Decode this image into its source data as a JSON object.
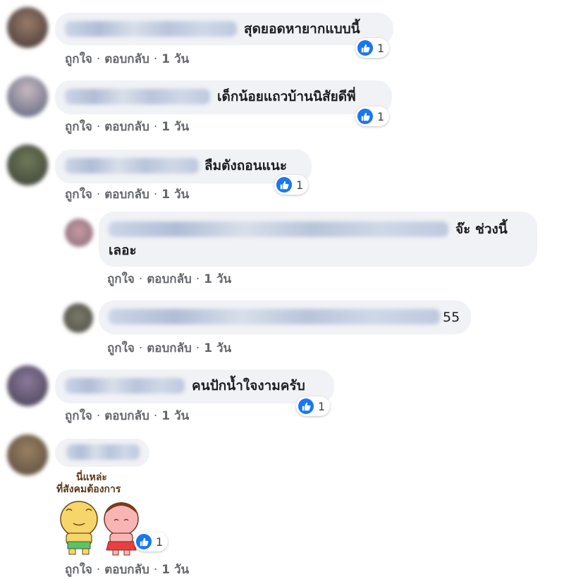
{
  "actions": {
    "like": "ถูกใจ",
    "reply": "ตอบกลับ",
    "sep": "·",
    "time": "1 วัน"
  },
  "comments": [
    {
      "text": "สุดยอดหายากแบบนี้",
      "reactions": "1"
    },
    {
      "text": "เด็กน้อยแถวบ้านนิสัยดีพี่",
      "reactions": "1"
    },
    {
      "text": "ลืมตังถอนแนะ",
      "reactions": "1"
    },
    {
      "text_line1": "จ๊ะ ช่วงนี้",
      "text_line2": "เลอะ"
    },
    {
      "text": "55"
    },
    {
      "text": "คนปักน้ำใจงามครับ",
      "reactions": "1"
    },
    {
      "sticker_text_line1": "นี่แหล่ะ",
      "sticker_text_line2": "ที่สังคมต้องการ",
      "reactions": "1"
    }
  ],
  "colors": {
    "like_blue": "#1877f2",
    "bubble": "#f0f2f5",
    "action_gray": "#65676b"
  }
}
